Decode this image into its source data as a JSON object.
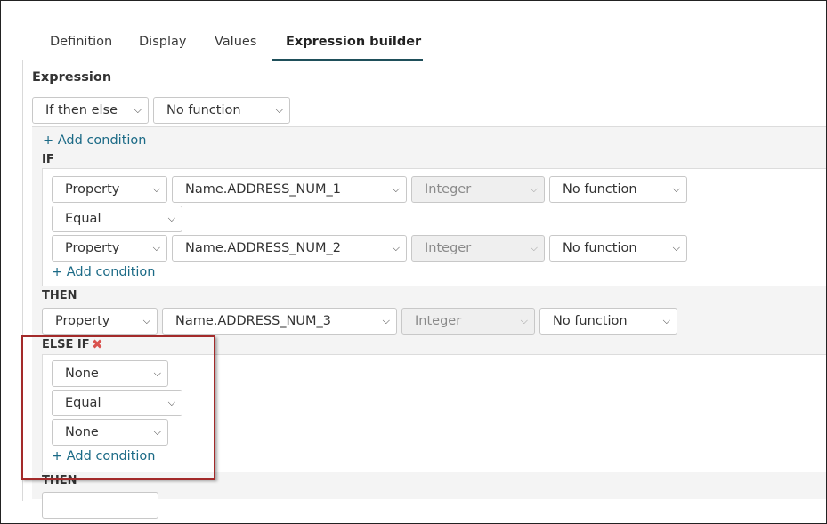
{
  "tabs": [
    {
      "label": "Definition"
    },
    {
      "label": "Display"
    },
    {
      "label": "Values"
    },
    {
      "label": "Expression builder"
    }
  ],
  "expression": {
    "label": "Expression",
    "type_select": "If then else",
    "function_select": "No function",
    "add_condition": "+ Add condition"
  },
  "if_block": {
    "label": "IF",
    "row1": {
      "source": "Property",
      "field": "Name.ADDRESS_NUM_1",
      "type": "Integer",
      "function": "No function"
    },
    "operator": "Equal",
    "row2": {
      "source": "Property",
      "field": "Name.ADDRESS_NUM_2",
      "type": "Integer",
      "function": "No function"
    },
    "add_condition": "+ Add condition"
  },
  "then_block": {
    "label": "THEN",
    "row": {
      "source": "Property",
      "field": "Name.ADDRESS_NUM_3",
      "type": "Integer",
      "function": "No function"
    }
  },
  "else_if_block": {
    "label": "ELSE IF",
    "remove_icon": "close-x-icon",
    "left": "None",
    "operator": "Equal",
    "right": "None",
    "add_condition": "+ Add condition"
  },
  "then_block_2": {
    "label": "THEN"
  },
  "colors": {
    "accent": "#1f4f5a",
    "link": "#1b6a86",
    "remove": "#d9534f",
    "highlight": "#a32a2a"
  }
}
